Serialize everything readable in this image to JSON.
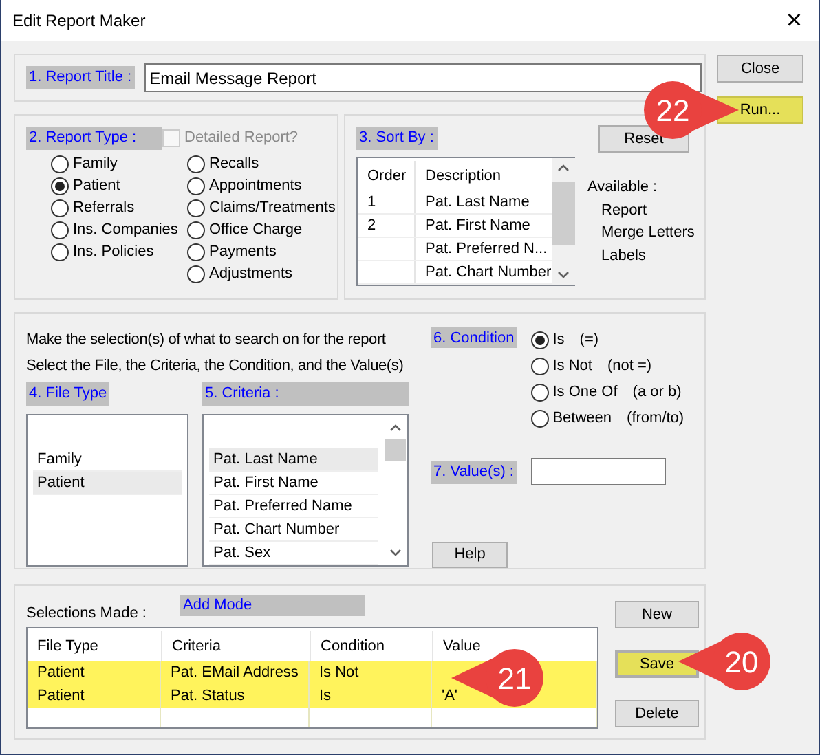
{
  "window": {
    "title": "Edit Report Maker",
    "close": "×"
  },
  "report_title": {
    "label": "1. Report Title :",
    "value": "Email Message Report"
  },
  "report_type": {
    "label": "2. Report Type :",
    "detailed": {
      "label": "Detailed Report?",
      "checked": false,
      "disabled": true
    },
    "columns": [
      [
        {
          "label": "Family",
          "selected": false
        },
        {
          "label": "Patient",
          "selected": true
        },
        {
          "label": "Referrals",
          "selected": false
        },
        {
          "label": "Ins. Companies",
          "selected": false
        },
        {
          "label": "Ins. Policies",
          "selected": false
        }
      ],
      [
        {
          "label": "Recalls",
          "selected": false
        },
        {
          "label": "Appointments",
          "selected": false
        },
        {
          "label": "Claims/Treatments",
          "selected": false
        },
        {
          "label": "Office Charge",
          "selected": false
        },
        {
          "label": "Payments",
          "selected": false
        },
        {
          "label": "Adjustments",
          "selected": false
        }
      ]
    ]
  },
  "sort_by": {
    "label": "3. Sort By :",
    "reset": "Reset",
    "columns": [
      "Order",
      "Description"
    ],
    "rows": [
      [
        "1",
        "Pat. Last Name"
      ],
      [
        "2",
        "Pat. First Name"
      ],
      [
        "",
        "Pat. Preferred N..."
      ],
      [
        "",
        "Pat. Chart Number"
      ]
    ],
    "available_label": "Available :",
    "available": [
      "Report",
      "Merge Letters",
      "Labels"
    ]
  },
  "instructions": [
    "Make the selection(s) of what to search on for the report",
    "Select the File, the Criteria, the Condition, and the Value(s)"
  ],
  "file_type": {
    "label": "4. File Type",
    "items": [
      {
        "label": "Family",
        "selected": false
      },
      {
        "label": "Patient",
        "selected": true
      }
    ]
  },
  "criteria": {
    "label": "5. Criteria :",
    "items": [
      {
        "label": "Pat. Last Name",
        "selected": true
      },
      {
        "label": "Pat. First Name",
        "selected": false
      },
      {
        "label": "Pat. Preferred Name",
        "selected": false
      },
      {
        "label": "Pat. Chart Number",
        "selected": false
      },
      {
        "label": "Pat. Sex",
        "selected": false
      }
    ]
  },
  "condition": {
    "label": "6. Condition",
    "options": [
      {
        "label": "Is",
        "hint": "(=)",
        "selected": true
      },
      {
        "label": "Is Not",
        "hint": "(not =)",
        "selected": false
      },
      {
        "label": "Is One Of",
        "hint": "(a or b)",
        "selected": false
      },
      {
        "label": "Between",
        "hint": "(from/to)",
        "selected": false
      }
    ]
  },
  "values": {
    "label": "7. Value(s) :"
  },
  "help": "Help",
  "selections": {
    "label": "Selections Made :",
    "mode": "Add Mode",
    "columns": [
      "File Type",
      "Criteria",
      "Condition",
      "Value"
    ],
    "rows": [
      {
        "cells": [
          "Patient",
          "Pat. EMail Address",
          "Is Not",
          ""
        ],
        "highlighted": true
      },
      {
        "cells": [
          "Patient",
          "Pat. Status",
          "Is",
          "'A'"
        ],
        "highlighted": true
      }
    ]
  },
  "row_buttons": [
    {
      "label": "New",
      "highlighted": false,
      "focused": false
    },
    {
      "label": "Save",
      "highlighted": true,
      "focused": true
    },
    {
      "label": "Delete",
      "highlighted": false,
      "focused": false
    }
  ],
  "side_buttons": [
    {
      "label": "Close",
      "highlighted": false
    },
    {
      "label": "Run...",
      "highlighted": true
    }
  ],
  "callouts": [
    {
      "text": "22"
    },
    {
      "text": "21"
    },
    {
      "text": "20"
    }
  ]
}
